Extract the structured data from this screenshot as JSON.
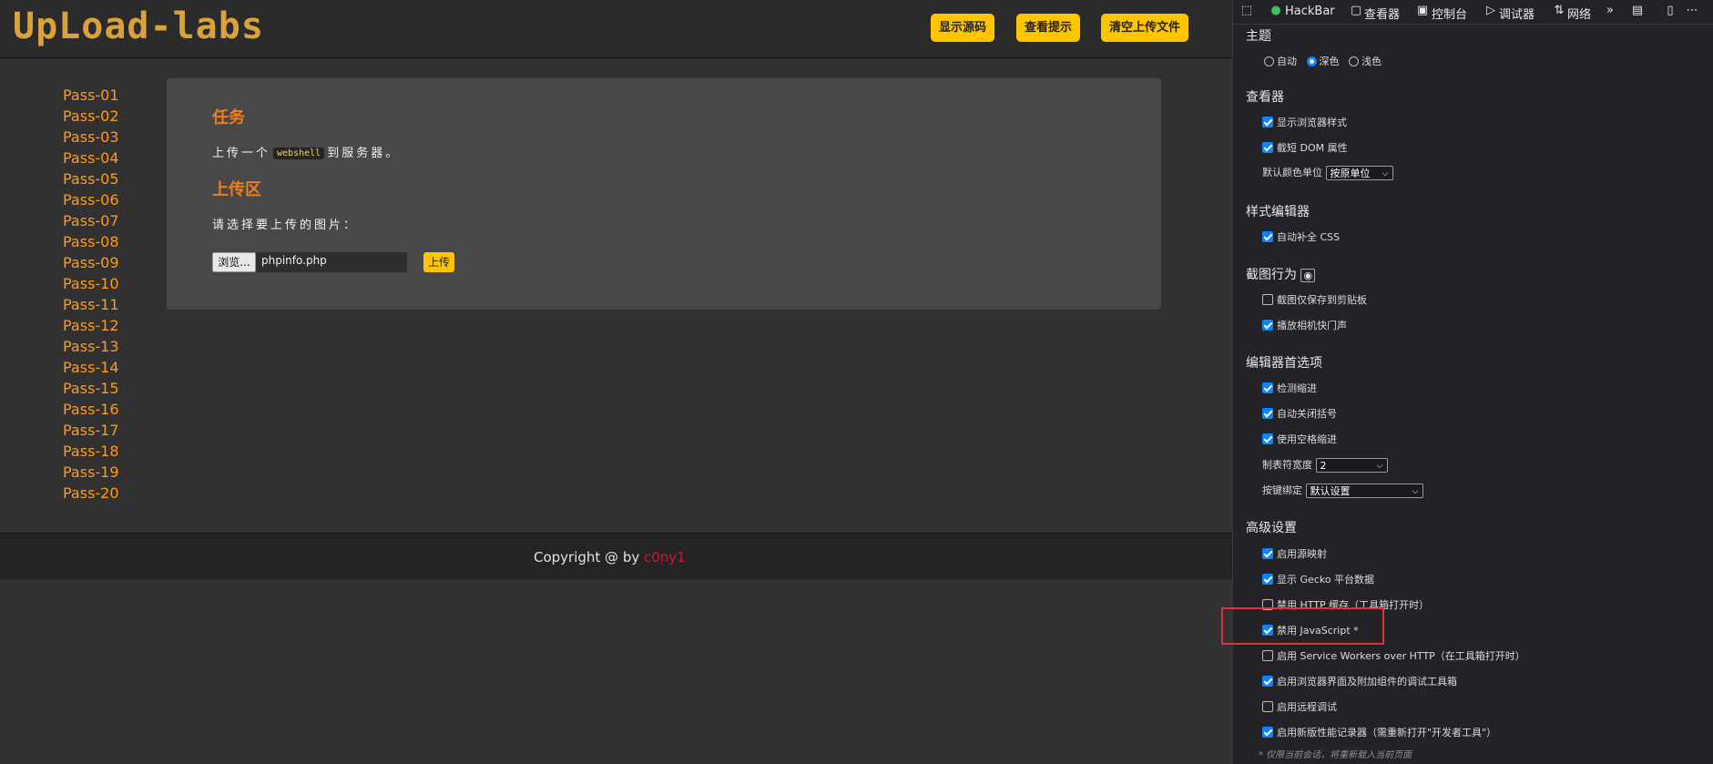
{
  "site": {
    "logo": "UpLoad-labs",
    "top_buttons": [
      "显示源码",
      "查看提示",
      "清空上传文件"
    ],
    "passes": [
      "Pass-01",
      "Pass-02",
      "Pass-03",
      "Pass-04",
      "Pass-05",
      "Pass-06",
      "Pass-07",
      "Pass-08",
      "Pass-09",
      "Pass-10",
      "Pass-11",
      "Pass-12",
      "Pass-13",
      "Pass-14",
      "Pass-15",
      "Pass-16",
      "Pass-17",
      "Pass-18",
      "Pass-19",
      "Pass-20"
    ],
    "task_heading": "任务",
    "task_prefix": "上传一个",
    "task_code": "webshell",
    "task_suffix": "到服务器。",
    "upload_heading": "上传区",
    "upload_prompt": "请选择要上传的图片：",
    "browse_label": "浏览...",
    "file_name": "phpinfo.php",
    "upload_button": "上传",
    "footer_text": "Copyright @  by ",
    "footer_author": "c0ny1"
  },
  "devtools": {
    "tabs": [
      "HackBar",
      "查看器",
      "控制台",
      "调试器",
      "网络"
    ],
    "sections": {
      "theme": {
        "title": "主题",
        "options": [
          {
            "label": "自动",
            "selected": false
          },
          {
            "label": "深色",
            "selected": true
          },
          {
            "label": "浅色",
            "selected": false
          }
        ]
      },
      "inspector": {
        "title": "查看器",
        "items": [
          {
            "label": "显示浏览器样式",
            "checked": true
          },
          {
            "label": "截短 DOM 属性",
            "checked": true
          }
        ],
        "color_unit_label": "默认颜色单位",
        "color_unit_value": "按原单位"
      },
      "style_editor": {
        "title": "样式编辑器",
        "items": [
          {
            "label": "自动补全 CSS",
            "checked": true
          }
        ]
      },
      "screenshot": {
        "title": "截图行为",
        "items": [
          {
            "label": "截图仅保存到剪贴板",
            "checked": false
          },
          {
            "label": "播放相机快门声",
            "checked": true
          }
        ]
      },
      "editor": {
        "title": "编辑器首选项",
        "items": [
          {
            "label": "检测缩进",
            "checked": true
          },
          {
            "label": "自动关闭括号",
            "checked": true
          },
          {
            "label": "使用空格缩进",
            "checked": true
          }
        ],
        "tab_size_label": "制表符宽度",
        "tab_size_value": "2",
        "keybinding_label": "按键绑定",
        "keybinding_value": "默认设置"
      },
      "advanced": {
        "title": "高级设置",
        "items": [
          {
            "label": "启用源映射",
            "checked": true
          },
          {
            "label": "显示 Gecko 平台数据",
            "checked": true
          },
          {
            "label": "禁用 HTTP 缓存（工具箱打开时）",
            "checked": false
          },
          {
            "label": "禁用 JavaScript *",
            "checked": true
          },
          {
            "label": "启用 Service Workers over HTTP（在工具箱打开时）",
            "checked": false
          },
          {
            "label": "启用浏览器界面及附加组件的调试工具箱",
            "checked": true
          },
          {
            "label": "启用远程调试",
            "checked": false
          },
          {
            "label": "启用新版性能记录器（需重新打开\"开发者工具\"）",
            "checked": true
          }
        ],
        "note": "* 仅限当前会话，将重新载入当前页面"
      }
    }
  }
}
